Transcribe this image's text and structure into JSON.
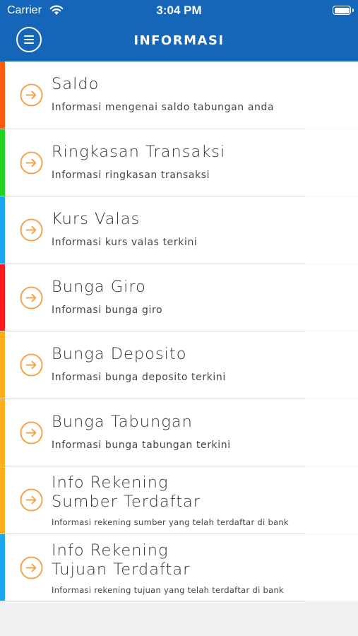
{
  "status_bar": {
    "carrier": "Carrier",
    "time": "3:04 PM"
  },
  "header": {
    "title": "INFORMASI",
    "menu_icon": "hamburger-icon"
  },
  "accent_color": "#1565b8",
  "arrow_color": "#f5a04a",
  "items": [
    {
      "title": "Saldo",
      "subtitle": "Informasi mengenai saldo tabungan anda",
      "color": "#ff5a0a"
    },
    {
      "title": "Ringkasan Transaksi",
      "subtitle": "Informasi ringkasan transaksi",
      "color": "#22d322"
    },
    {
      "title": "Kurs Valas",
      "subtitle": "Informasi kurs valas terkini",
      "color": "#1aa6f0"
    },
    {
      "title": "Bunga Giro",
      "subtitle": "Informasi bunga giro",
      "color": "#ff1a1a"
    },
    {
      "title": "Bunga Deposito",
      "subtitle": "Informasi bunga deposito terkini",
      "color": "#ffad1a"
    },
    {
      "title": "Bunga Tabungan",
      "subtitle": "Informasi bunga tabungan terkini",
      "color": "#ffad1a"
    },
    {
      "title_line1": "Info Rekening",
      "title_line2": "Sumber Terdaftar",
      "subtitle": "Informasi rekening sumber yang telah terdaftar di bank",
      "color": "#ffad1a"
    },
    {
      "title_line1": "Info Rekening",
      "title_line2": "Tujuan Terdaftar",
      "subtitle": "Informasi rekening tujuan yang telah terdaftar di bank",
      "color": "#1aa6f0"
    }
  ]
}
